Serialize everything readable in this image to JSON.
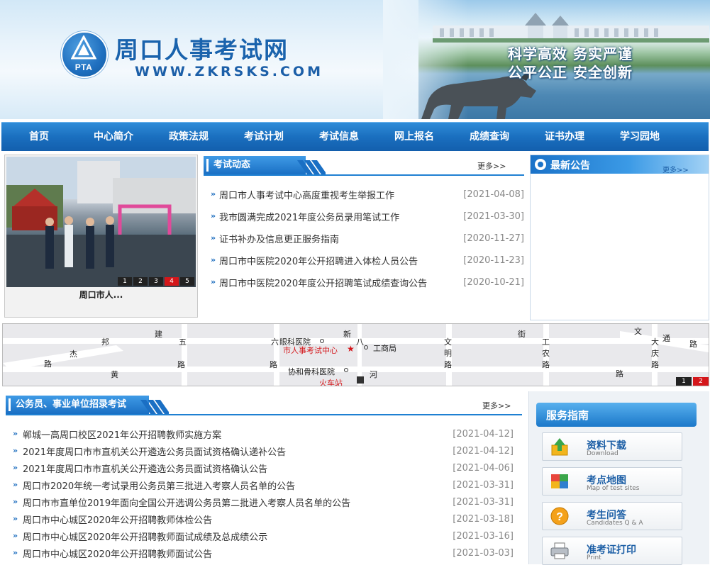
{
  "header": {
    "logo_text": "PTA",
    "title": "周口人事考试网",
    "url": "WWW.ZKRSKS.COM",
    "slogan_line1": "科学高效  务实严谨",
    "slogan_line2": "公平公正  安全创新"
  },
  "nav": {
    "items": [
      {
        "label": "首页"
      },
      {
        "label": "中心简介"
      },
      {
        "label": "政策法规"
      },
      {
        "label": "考试计划"
      },
      {
        "label": "考试信息"
      },
      {
        "label": "网上报名"
      },
      {
        "label": "成绩查询"
      },
      {
        "label": "证书办理"
      },
      {
        "label": "学习园地"
      }
    ]
  },
  "slideshow": {
    "caption": "周口市人...",
    "pages": [
      "1",
      "2",
      "3",
      "4",
      "5"
    ],
    "active_page": "4"
  },
  "exam_news": {
    "title": "考试动态",
    "more": "更多>>",
    "items": [
      {
        "title": "周口市人事考试中心高度重视考生举报工作",
        "date": "[2021-04-08]"
      },
      {
        "title": "我市圆满完成2021年度公务员录用笔试工作",
        "date": "[2021-03-30]"
      },
      {
        "title": "证书补办及信息更正服务指南",
        "date": "[2020-11-27]"
      },
      {
        "title": "周口市中医院2020年公开招聘进入体检人员公告",
        "date": "[2020-11-23]"
      },
      {
        "title": "周口市中医院2020年度公开招聘笔试成绩查询公告",
        "date": "[2020-10-21]"
      }
    ]
  },
  "notice": {
    "title": "最新公告",
    "more": "更多>>"
  },
  "map": {
    "labels": {
      "jian": "建",
      "xin": "新",
      "jie": "街",
      "wen": "文",
      "tong": "通",
      "bang": "邦",
      "jie2": "杰",
      "lu1": "路",
      "huang": "黄",
      "he": "河",
      "wu": "五",
      "lu2": "路",
      "liu": "六",
      "lu3": "路",
      "ba": "八",
      "wenming1": "文",
      "wenming2": "明",
      "lu4": "路",
      "gongnong1": "工",
      "gongnong2": "农",
      "lu5": "路",
      "daqing1": "大",
      "daqing2": "庆",
      "lu6": "路",
      "lu7": "路",
      "lu8": "路"
    },
    "places": {
      "eye_hospital": "眼科医院",
      "center": "市人事考试中心",
      "commerce_bureau": "工商局",
      "ortho_hospital": "协和骨科医院",
      "station": "火车站"
    },
    "pages": [
      "1",
      "2"
    ],
    "active_page": "2"
  },
  "recruit": {
    "title": "公务员、事业单位招录考试",
    "more": "更多>>",
    "items": [
      {
        "title": "郸城一高周口校区2021年公开招聘教师实施方案",
        "date": "[2021-04-12]"
      },
      {
        "title": "2021年度周口市市直机关公开遴选公务员面试资格确认递补公告",
        "date": "[2021-04-12]"
      },
      {
        "title": "2021年度周口市市直机关公开遴选公务员面试资格确认公告",
        "date": "[2021-04-06]"
      },
      {
        "title": "周口市2020年统一考试录用公务员第三批进入考察人员名单的公告",
        "date": "[2021-03-31]"
      },
      {
        "title": "周口市市直单位2019年面向全国公开选调公务员第二批进入考察人员名单的公告",
        "date": "[2021-03-31]"
      },
      {
        "title": "周口市中心城区2020年公开招聘教师体检公告",
        "date": "[2021-03-18]"
      },
      {
        "title": "周口市中心城区2020年公开招聘教师面试成绩及总成绩公示",
        "date": "[2021-03-16]"
      },
      {
        "title": "周口市中心城区2020年公开招聘教师面试公告",
        "date": "[2021-03-03]"
      }
    ]
  },
  "service": {
    "title": "服务指南",
    "buttons": [
      {
        "cn": "资料下载",
        "en": "Download",
        "icon": "download-icon"
      },
      {
        "cn": "考点地图",
        "en": "Map of test sites",
        "icon": "map-icon"
      },
      {
        "cn": "考生问答",
        "en": "Candidates Q & A",
        "icon": "question-icon"
      },
      {
        "cn": "准考证打印",
        "en": "Print",
        "icon": "printer-icon"
      }
    ]
  },
  "colors": {
    "primary_blue": "#1a6fbf",
    "nav_blue": "#1f7bd0",
    "active_red": "#d4171b"
  }
}
